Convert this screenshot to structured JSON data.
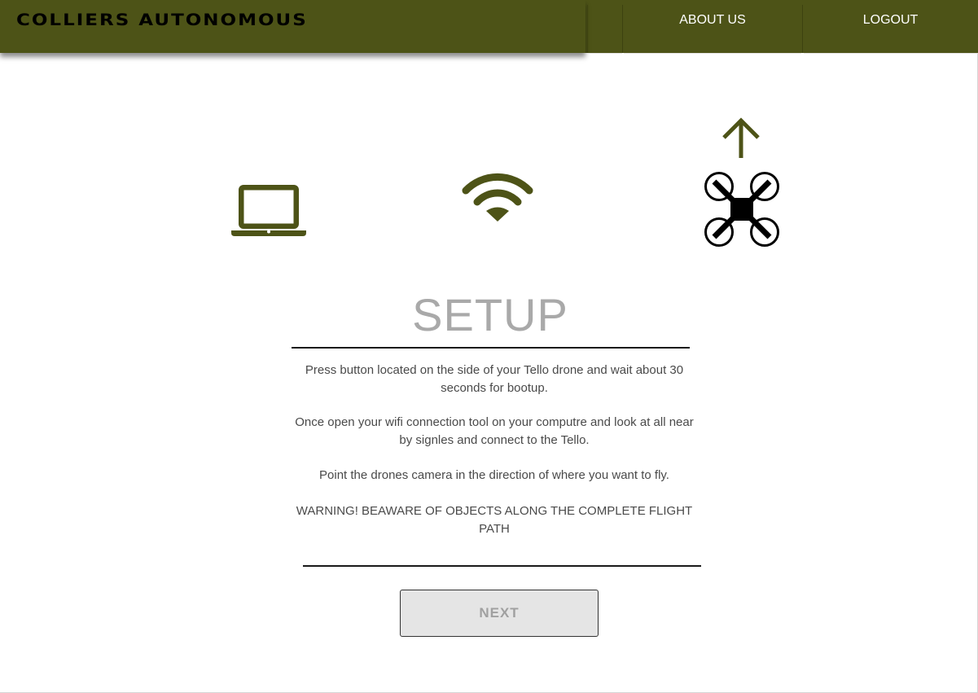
{
  "header": {
    "brand": "COLLIERS AUTONOMOUS",
    "nav": [
      {
        "label": "ABOUT US"
      },
      {
        "label": "LOGOUT"
      }
    ]
  },
  "steps": {
    "icons": [
      "laptop-icon",
      "wifi-icon",
      "arrow-up-icon",
      "drone-icon"
    ]
  },
  "setup": {
    "title": "SETUP",
    "instructions": [
      "Press button located on the side of your Tello drone and wait about 30 seconds for bootup.",
      "Once open your wifi connection tool on your computre and look at all near by signles and connect to the Tello.",
      "Point the drones camera in the direction of where you want to fly.",
      "WARNING! BEAWARE OF OBJECTS ALONG THE COMPLETE FLIGHT PATH"
    ],
    "next_label": "NEXT"
  },
  "colors": {
    "header_bg": "#4d5317",
    "accent": "#4d5317",
    "title": "#a9a9a9",
    "button_bg": "#e5e5e5"
  }
}
